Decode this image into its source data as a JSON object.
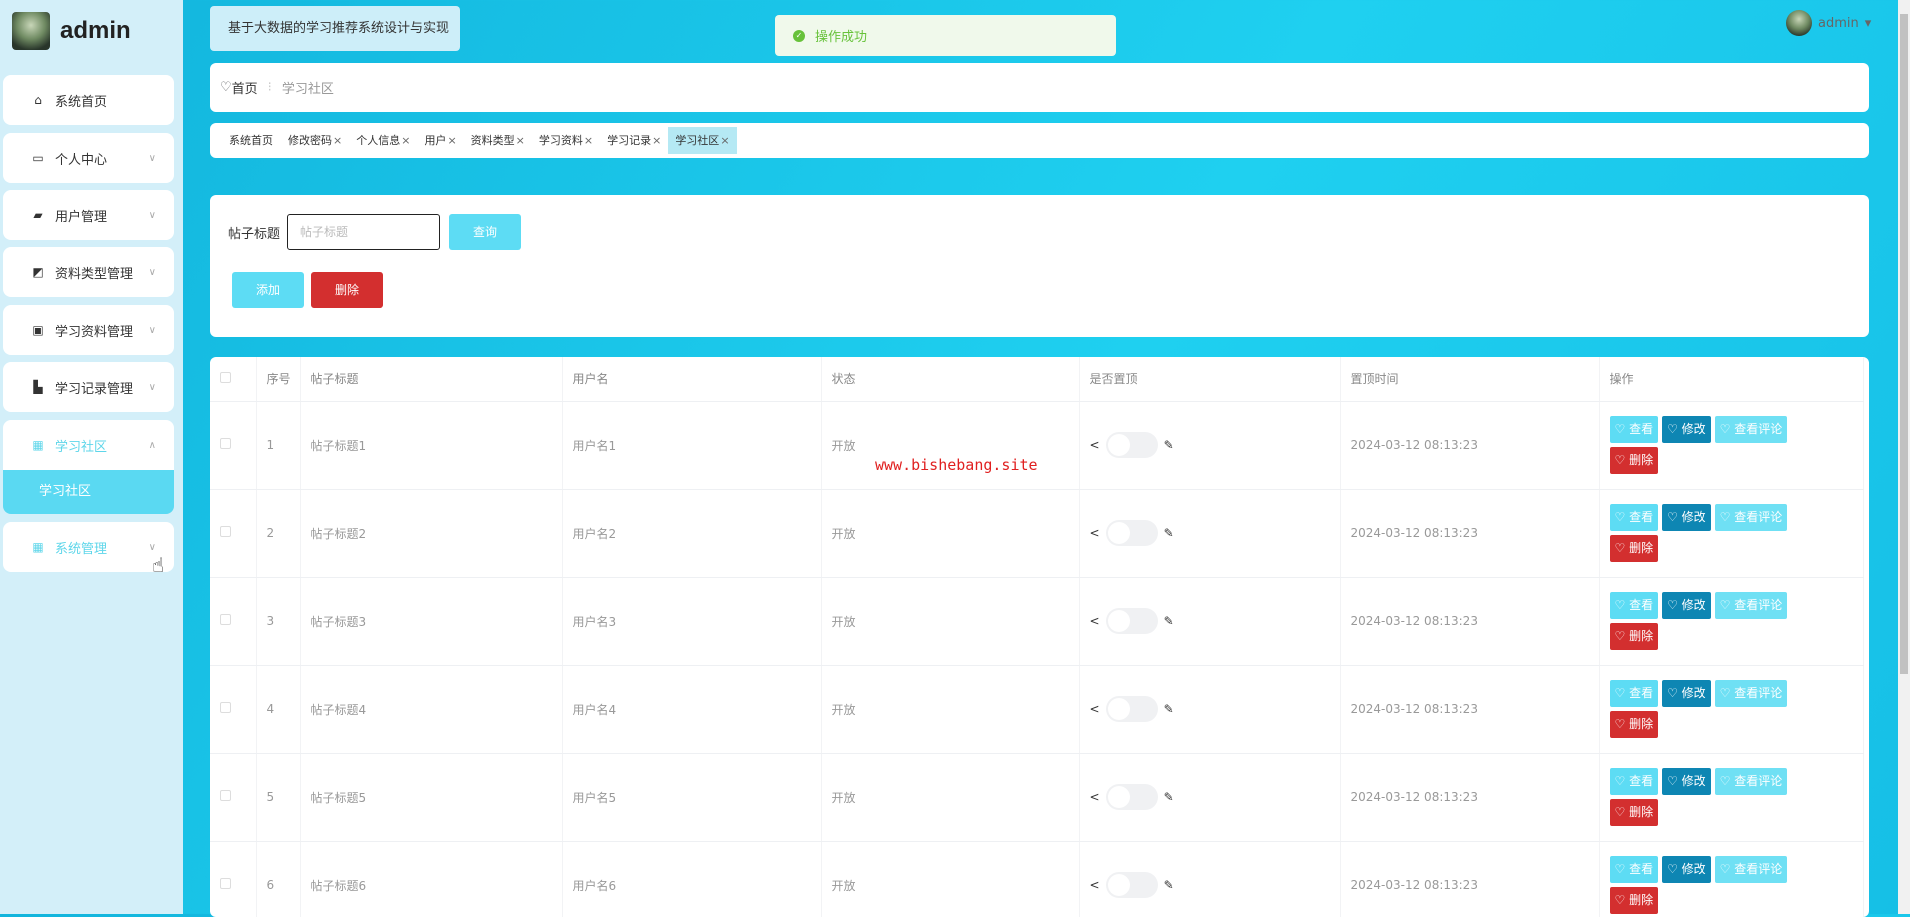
{
  "sidebar": {
    "username": "admin",
    "items": [
      {
        "label": "系统首页",
        "icon": "home-icon"
      },
      {
        "label": "个人中心",
        "icon": "id-card-icon"
      },
      {
        "label": "用户管理",
        "icon": "ticket-icon"
      },
      {
        "label": "资料类型管理",
        "icon": "chart-icon"
      },
      {
        "label": "学习资料管理",
        "icon": "clipboard-icon"
      },
      {
        "label": "学习记录管理",
        "icon": "bar-icon"
      },
      {
        "label": "学习社区",
        "icon": "grid-icon"
      },
      {
        "label": "系统管理",
        "icon": "grid-icon"
      }
    ],
    "submenu": "学习社区"
  },
  "header": {
    "title": "基于大数据的学习推荐系统设计与实现",
    "toast": "操作成功",
    "user": "admin"
  },
  "breadcrumb": {
    "home": "首页",
    "current": "学习社区"
  },
  "tabs": [
    {
      "label": "系统首页",
      "close": ""
    },
    {
      "label": "修改密码",
      "close": "×"
    },
    {
      "label": "个人信息",
      "close": "×"
    },
    {
      "label": "用户",
      "close": "×"
    },
    {
      "label": "资料类型",
      "close": "×"
    },
    {
      "label": "学习资料",
      "close": "×"
    },
    {
      "label": "学习记录",
      "close": "×"
    },
    {
      "label": "学习社区",
      "close": "×"
    }
  ],
  "search": {
    "label": "帖子标题",
    "placeholder": "帖子标题",
    "query": "查询",
    "add": "添加",
    "delete": "删除"
  },
  "table": {
    "headers": [
      "序号",
      "帖子标题",
      "用户名",
      "状态",
      "是否置顶",
      "置顶时间",
      "操作"
    ],
    "actions": {
      "view": "♡ 查看",
      "edit": "♡ 修改",
      "comments": "♡ 查看评论",
      "delete": "♡ 删除"
    },
    "rows": [
      {
        "no": "1",
        "title": "帖子标题1",
        "user": "用户名1",
        "status": "开放",
        "time": "2024-03-12 08:13:23"
      },
      {
        "no": "2",
        "title": "帖子标题2",
        "user": "用户名2",
        "status": "开放",
        "time": "2024-03-12 08:13:23"
      },
      {
        "no": "3",
        "title": "帖子标题3",
        "user": "用户名3",
        "status": "开放",
        "time": "2024-03-12 08:13:23"
      },
      {
        "no": "4",
        "title": "帖子标题4",
        "user": "用户名4",
        "status": "开放",
        "time": "2024-03-12 08:13:23"
      },
      {
        "no": "5",
        "title": "帖子标题5",
        "user": "用户名5",
        "status": "开放",
        "time": "2024-03-12 08:13:23"
      },
      {
        "no": "6",
        "title": "帖子标题6",
        "user": "用户名6",
        "status": "开放",
        "time": "2024-03-12 08:13:23"
      }
    ]
  },
  "watermark": "www.bishebang.site"
}
